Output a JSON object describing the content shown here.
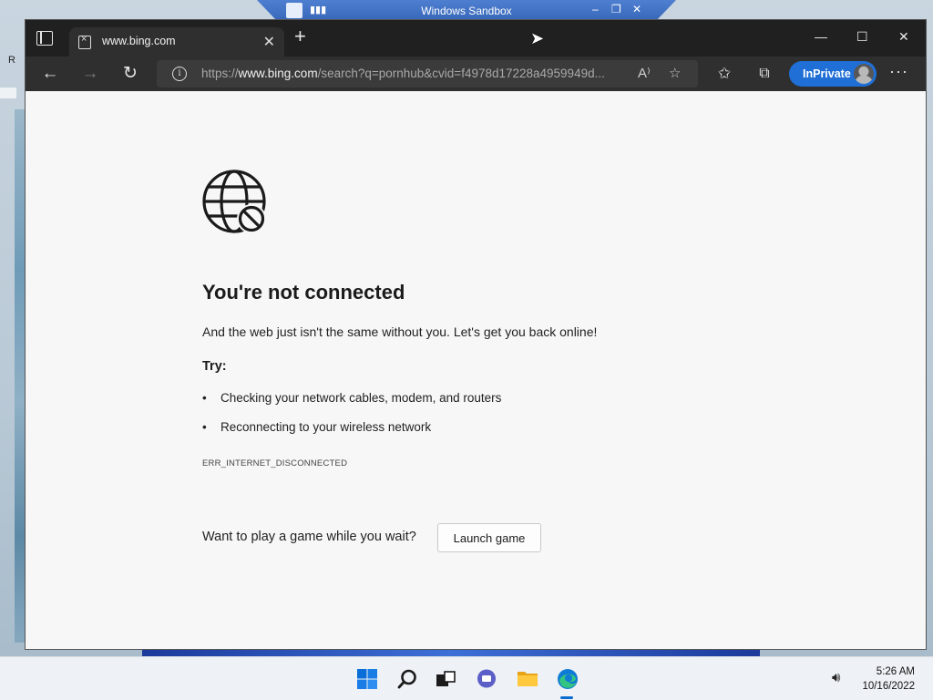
{
  "desktop": {
    "corner_letter": "R"
  },
  "sandbox": {
    "title": "Windows Sandbox",
    "minimize": "‒",
    "restore": "❐",
    "close": "✕"
  },
  "browser": {
    "tab": {
      "title": "www.bing.com",
      "close": "✕"
    },
    "new_tab": "+",
    "window_controls": {
      "minimize": "—",
      "maximize": "☐",
      "close": "✕"
    },
    "nav": {
      "back": "←",
      "forward": "→",
      "refresh": "↻"
    },
    "address": {
      "scheme": "https://",
      "host": "www.bing.com",
      "path": "/search?q=pornhub&cvid=f4978d17228a4959949d..."
    },
    "read_aloud": "A⁾",
    "inprivate_label": "InPrivate",
    "more": "···"
  },
  "error_page": {
    "title": "You're not connected",
    "description": "And the web just isn't the same without you. Let's get you back online!",
    "try_label": "Try:",
    "bullet": "•",
    "tips": [
      "Checking your network cables, modem, and routers",
      "Reconnecting to your wireless network"
    ],
    "error_code": "ERR_INTERNET_DISCONNECTED",
    "game_prompt": "Want to play a game while you wait?",
    "launch_button": "Launch game"
  },
  "taskbar": {
    "icons": [
      "windows-start-icon",
      "search-icon",
      "task-view-icon",
      "teams-chat-icon",
      "file-explorer-icon",
      "edge-icon"
    ],
    "time": "5:26 AM",
    "date": "10/16/2022"
  }
}
